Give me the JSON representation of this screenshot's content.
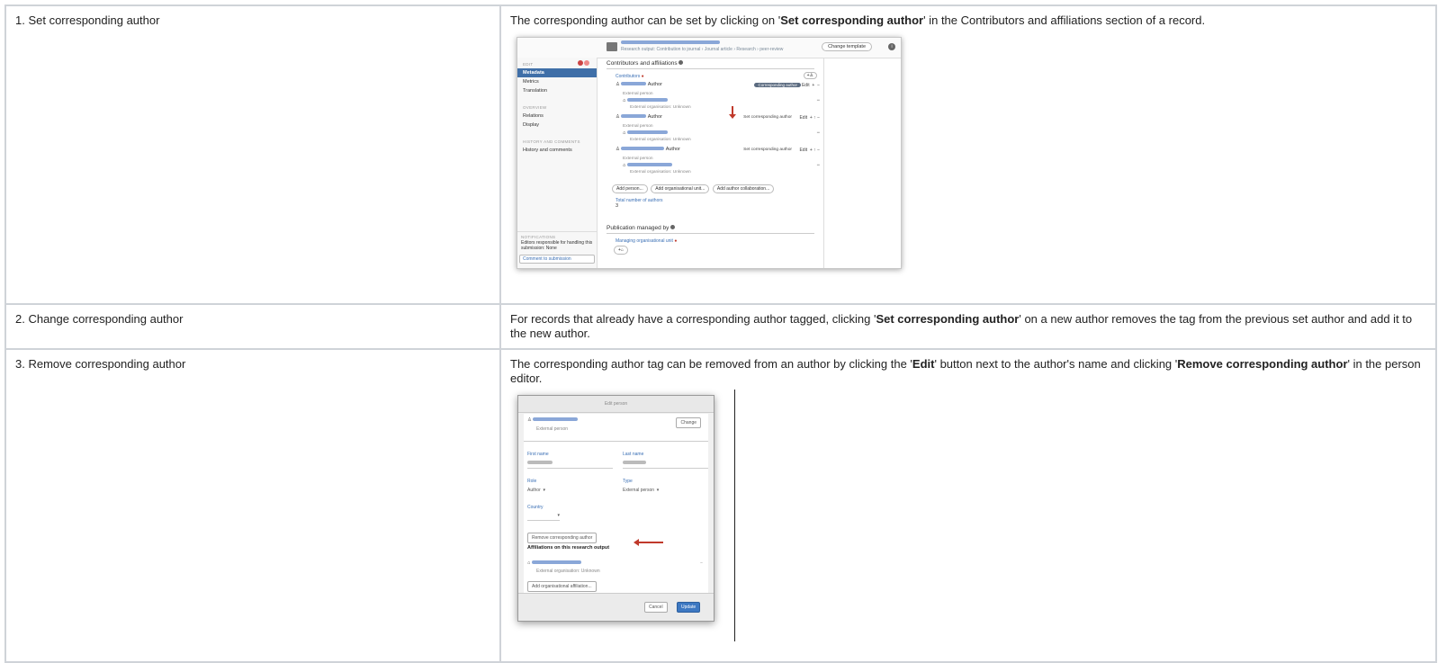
{
  "rows": [
    {
      "step": "1. Set corresponding author",
      "desc": {
        "pre": "The corresponding author can be set by clicking on '",
        "bold": "Set corresponding author",
        "post": "' in the Contributors and affiliations section of a record."
      }
    },
    {
      "step": "2. Change corresponding author",
      "desc": {
        "pre": "For records that already have a corresponding author tagged, clicking '",
        "bold": "Set corresponding author",
        "post": "' on a new author removes the tag from the previous set author and add it to the new author."
      }
    },
    {
      "step": "3. Remove corresponding author",
      "desc": {
        "pre": "The corresponding author tag can be removed from an author by clicking the '",
        "bold1": "Edit",
        "mid": "' button next to the author's name and clicking '",
        "bold2": "Remove corresponding author",
        "post": "' in the person editor."
      }
    }
  ],
  "screenshot1": {
    "breadcrumb": "Research output: Contribution to journal › Journal article › Research › peer-review",
    "change_template": "Change template",
    "sidebar": {
      "edit_heading": "EDIT",
      "items_edit": [
        "Metadata",
        "Metrics",
        "Translation"
      ],
      "overview_heading": "OVERVIEW",
      "items_overview": [
        "Relations",
        "Display"
      ],
      "history_heading": "HISTORY AND COMMENTS",
      "items_history": [
        "History and comments"
      ],
      "notif_heading": "NOTIFICATIONS",
      "notif_text": "Editors responsible for handling this submission: None",
      "comment_button": "Comment to submission"
    },
    "section_title": "Contributors and affiliations",
    "contributors_label": "Contributors",
    "role": "Author",
    "external_person": "External person",
    "external_org": "External organisation: Unknown",
    "corresponding_tag": "Corresponding author",
    "edit": "Edit",
    "set_corresponding": "Set corresponding author",
    "buttons": [
      "Add person...",
      "Add organisational unit...",
      "Add author collaboration..."
    ],
    "total_label": "Total number of authors",
    "total_value": "3",
    "managed_title": "Publication managed by",
    "managing_unit": "Managing organisational unit"
  },
  "screenshot2": {
    "dialog_title": "Edit person",
    "external_person": "External person",
    "change": "Change",
    "first_name_label": "First name",
    "last_name_label": "Last name",
    "role_label": "Role",
    "role_value": "Author",
    "type_label": "Type",
    "type_value": "External person",
    "country_label": "Country",
    "remove_button": "Remove corresponding author",
    "affiliations_text": "Affiliations on this research output",
    "external_org": "External organisation: Unknown",
    "add_aff_button": "Add organisational affiliation...",
    "cancel": "Cancel",
    "update": "Update"
  }
}
